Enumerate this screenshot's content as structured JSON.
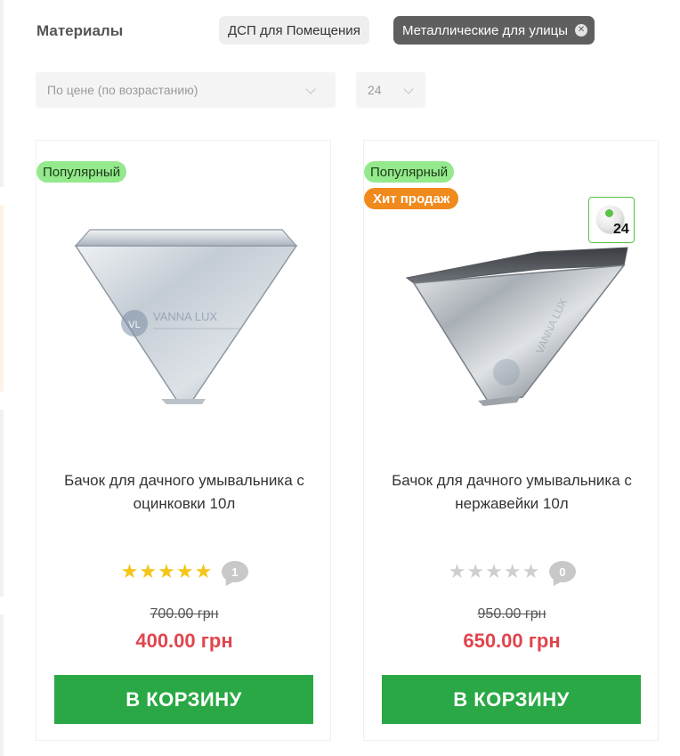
{
  "filters": {
    "title": "Материалы",
    "chips": [
      {
        "label": "ДСП для Помещения",
        "active": false
      },
      {
        "label": "Металлические для улицы",
        "active": true
      }
    ],
    "chip_close_icon": "close-icon"
  },
  "sort": {
    "selected": "По цене (по возрастанию)",
    "per_page": "24"
  },
  "colors": {
    "popular_badge": "#93e98c",
    "hit_badge": "#f08a1c",
    "price": "#e0454d",
    "cart_button": "#2aa845",
    "star_on": "#f5c518",
    "star_off": "#cfcfcf"
  },
  "products": [
    {
      "badges": [
        "Популярный"
      ],
      "title": "Бачок для дачного умывальника с оцинковки 10л",
      "rating": 5,
      "reviews": "1",
      "old_price": "700.00 грн",
      "price": "400.00 грн",
      "cart_label": "В КОРЗИНУ",
      "image_watermark": "VANNA LUX"
    },
    {
      "badges": [
        "Популярный",
        "Хит продаж"
      ],
      "compare_count": "24",
      "title": "Бачок для дачного умывальника с нержавейки 10л",
      "rating": 0,
      "reviews": "0",
      "old_price": "950.00 грн",
      "price": "650.00 грн",
      "cart_label": "В КОРЗИНУ",
      "image_watermark": "VANNA LUX"
    }
  ]
}
